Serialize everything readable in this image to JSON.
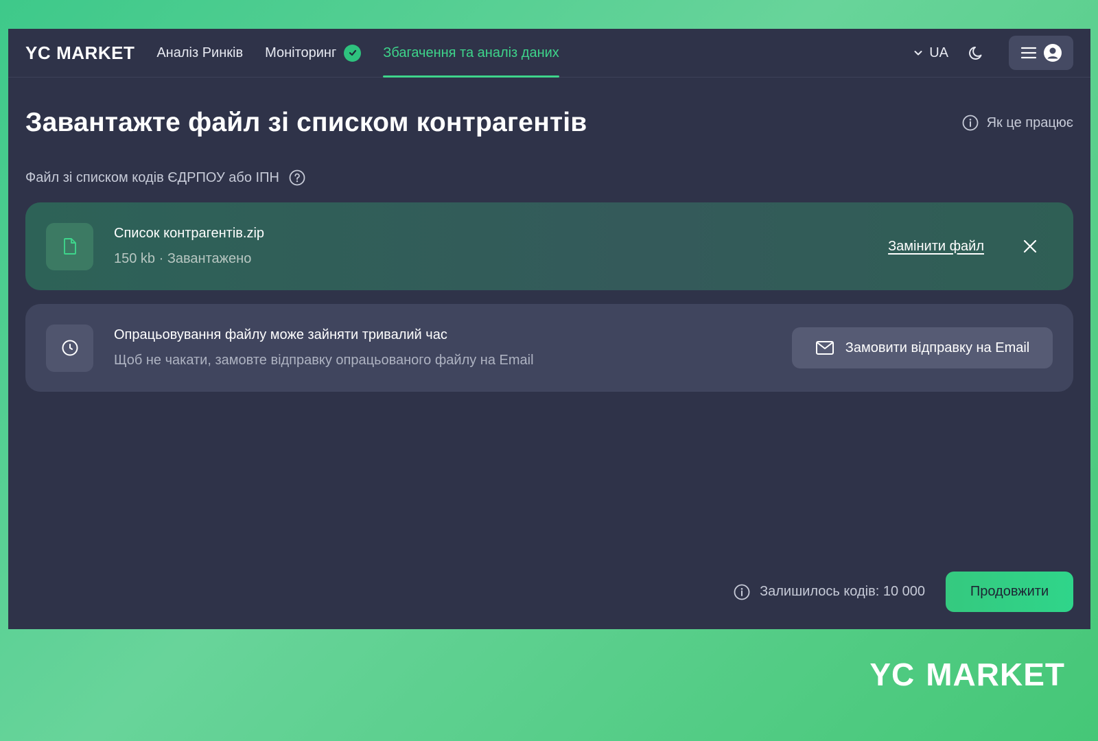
{
  "brand": {
    "logo_yc": "YC",
    "logo_market": "MARKET"
  },
  "nav": {
    "links": [
      {
        "label": "Аналіз Ринків"
      },
      {
        "label": "Моніторинг",
        "badge": "check"
      },
      {
        "label": "Збагачення та аналіз даних",
        "active": true
      }
    ],
    "language": "UA",
    "accent_color": "#3ed58b"
  },
  "page": {
    "title": "Завантажте файл зі списком контрагентів",
    "how_it_works": "Як це працює",
    "file_label": "Файл зі списком кодів ЄДРПОУ або ІПН"
  },
  "file_card": {
    "file_name": "Список контрагентів.zip",
    "file_meta": "150 kb · Завантажено",
    "replace_label": "Замінити файл",
    "icon": "document-icon"
  },
  "info_card": {
    "title": "Опрацьовування файлу може зайняти тривалий час",
    "subtitle": "Щоб не чакати, замовте відправку опрацьованого файлу на Email",
    "email_button": "Замовити відправку на Email",
    "icon": "clock-icon"
  },
  "footer": {
    "codes_left": "Залишилось кодів: 10 000",
    "continue_label": "Продовжити"
  },
  "watermark": {
    "yc": "YC",
    "market": "MARKET"
  }
}
